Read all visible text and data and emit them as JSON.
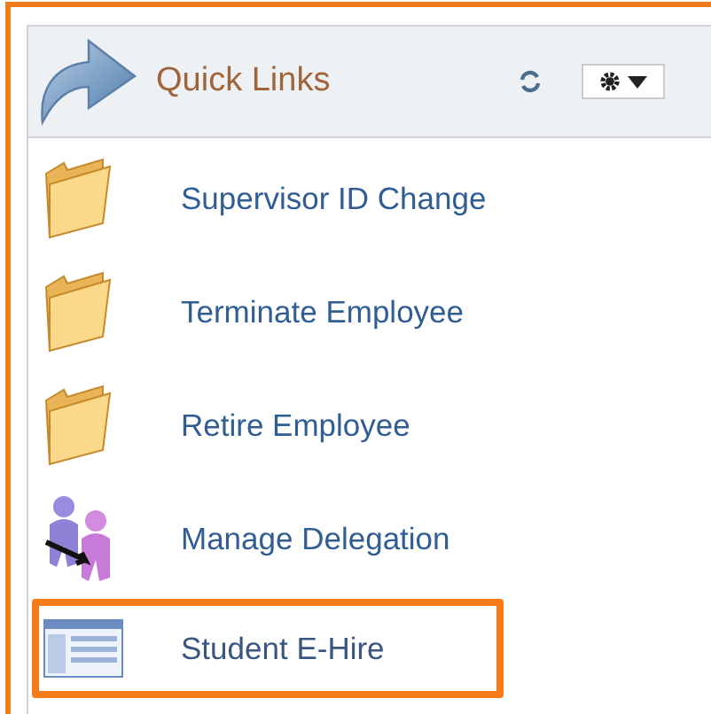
{
  "header": {
    "title": "Quick Links"
  },
  "links": [
    {
      "label": "Supervisor ID Change",
      "kind": "folder",
      "highlighted": false
    },
    {
      "label": "Terminate Employee",
      "kind": "folder",
      "highlighted": false
    },
    {
      "label": "Retire Employee",
      "kind": "folder",
      "highlighted": false
    },
    {
      "label": "Manage Delegation",
      "kind": "delegation",
      "highlighted": false
    },
    {
      "label": "Student E-Hire",
      "kind": "page",
      "highlighted": true
    }
  ]
}
